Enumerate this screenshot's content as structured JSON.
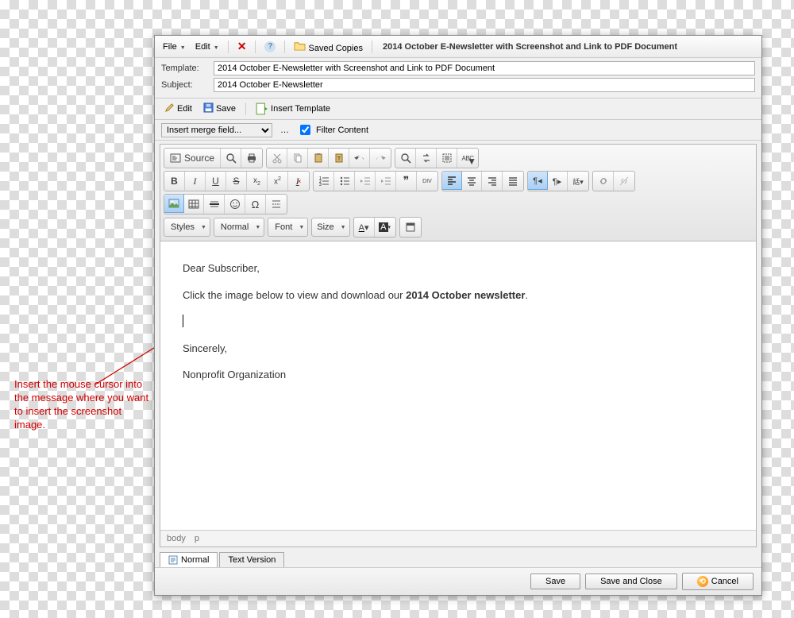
{
  "annotation": "Insert the mouse cursor into the message where you want to insert the screenshot image.",
  "menu": {
    "file": "File",
    "edit": "Edit",
    "saved_copies": "Saved Copies",
    "title": "2014 October E-Newsletter with Screenshot and Link to PDF Document"
  },
  "fields": {
    "template_label": "Template:",
    "template_value": "2014 October E-Newsletter with Screenshot and Link to PDF Document",
    "subject_label": "Subject:",
    "subject_value": "2014 October E-Newsletter"
  },
  "toolbar1": {
    "edit": "Edit",
    "save": "Save",
    "insert_template": "Insert Template"
  },
  "toolbar2": {
    "merge_placeholder": "Insert merge field...",
    "filter_label": "Filter Content"
  },
  "ck": {
    "source": "Source",
    "styles": "Styles",
    "format": "Normal",
    "font": "Font",
    "size": "Size"
  },
  "body": {
    "greeting": "Dear Subscriber,",
    "line1_a": "Click the image below to view and download our ",
    "line1_b": "2014 October newsletter",
    "line1_c": ".",
    "closing": "Sincerely,",
    "signature": "Nonprofit Organization"
  },
  "status": {
    "a": "body",
    "b": "p"
  },
  "tabs": {
    "normal": "Normal",
    "text": "Text Version"
  },
  "buttons": {
    "save": "Save",
    "save_close": "Save and Close",
    "cancel": "Cancel"
  }
}
